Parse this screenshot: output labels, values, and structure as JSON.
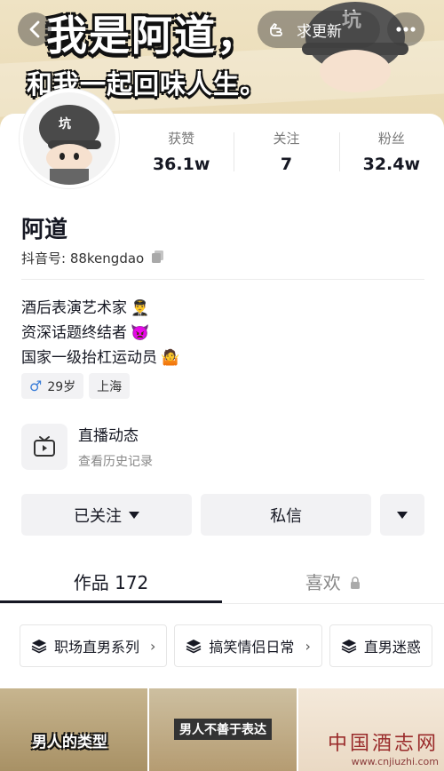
{
  "banner": {
    "slogan_line1": "我是阿道，",
    "slogan_line2": "和我一起回味人生。",
    "pill_label": "求更新",
    "icons": [
      "back-arrow-icon",
      "hand-pointing-icon",
      "more-dots-icon"
    ]
  },
  "profile": {
    "name": "阿道",
    "douyin_id": "抖音号: 88kengdao",
    "stats": [
      {
        "label": "获赞",
        "value": "36.1w"
      },
      {
        "label": "关注",
        "value": "7"
      },
      {
        "label": "粉丝",
        "value": "32.4w"
      }
    ],
    "bio": [
      {
        "text": "酒后表演艺术家",
        "emoji": "👨‍✈️"
      },
      {
        "text": "资深话题终结者",
        "emoji": "👿"
      },
      {
        "text": "国家一级抬杠运动员",
        "emoji": "🤷"
      }
    ],
    "tags": [
      {
        "icon": "male-icon",
        "symbol": "♂",
        "text": "29岁"
      },
      {
        "text": "上海"
      }
    ]
  },
  "live": {
    "title": "直播动态",
    "subtitle": "查看历史记录"
  },
  "actions": {
    "follow_label": "已关注",
    "message_label": "私信"
  },
  "tabs": {
    "works": "作品 172",
    "likes": "喜欢"
  },
  "collections": [
    {
      "label": "职场直男系列"
    },
    {
      "label": "搞笑情侣日常"
    },
    {
      "label": "直男迷惑"
    }
  ],
  "thumbnails": [
    {
      "caption": "男人的类型"
    },
    {
      "caption": "男人不善于表达"
    },
    {
      "caption": ""
    }
  ],
  "watermark": {
    "line1": "中国酒志网",
    "line2": "www.cnjiuzhi.com"
  },
  "colors": {
    "banner_bg": "#efe3c4",
    "primary_text": "#161823",
    "button_bg": "#f2f2f4",
    "male_icon": "#3a7dd8"
  }
}
